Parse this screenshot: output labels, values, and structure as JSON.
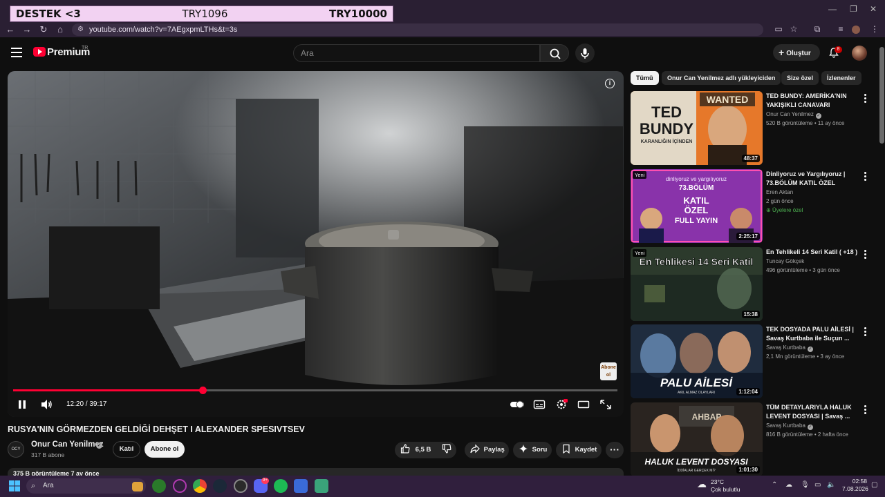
{
  "overlay": {
    "left": "DESTEK <3",
    "middle": "TRY1096",
    "right": "TRY10000"
  },
  "browser": {
    "url": "youtube.com/watch?v=7AEgxpmLTHs&t=3s"
  },
  "header": {
    "logo_text": "Premium",
    "country_code": "TR",
    "search_placeholder": "Ara",
    "create_label": "Oluştur",
    "notification_count": "8"
  },
  "player": {
    "time": "12:20 / 39:17",
    "progress_fraction": 0.314,
    "watermark_text": "Abone ol"
  },
  "video": {
    "title": "RUSYA'NIN GÖRMEZDEN GELDİĞİ DEHŞET I ALEXANDER SPESIVTSEV",
    "channel": "Onur Can Yenilmez",
    "subscribers": "317 B abone",
    "join_label": "Katıl",
    "subscribe_label": "Abone ol",
    "likes": "6,5 B",
    "share_label": "Paylaş",
    "ask_label": "Soru",
    "save_label": "Kaydet",
    "views_date": "375 B görüntüleme  7 ay önce"
  },
  "sidebar": {
    "chips": [
      "Tümü",
      "Onur Can Yenilmez adlı yükleyiciden",
      "Size özel",
      "İzlenenler"
    ],
    "items": [
      {
        "title": "TED BUNDY: AMERİKA'NIN YAKIŞIKLI CANAVARI",
        "channel": "Onur Can Yenilmez",
        "meta": "520 B görüntüleme • 11 ay önce",
        "duration": "48:37",
        "new": "",
        "members": "",
        "verified": true
      },
      {
        "title": "Dinliyoruz ve Yargılıyoruz | 73.BÖLÜM KATIL ÖZEL",
        "channel": "Eren Aktan",
        "meta": "2 gün önce",
        "duration": "2:25:17",
        "new": "Yeni",
        "members": "Üyelere özel",
        "verified": false
      },
      {
        "title": "En Tehlikeli 14 Seri Katil ( +18 )",
        "channel": "Tuncay Gökçek",
        "meta": "496 görüntüleme • 3 gün önce",
        "duration": "15:38",
        "new": "Yeni",
        "members": "",
        "verified": false
      },
      {
        "title": "TEK DOSYADA PALU AİLESİ | Savaş Kurtbaba ile Suçun ...",
        "channel": "Savaş Kurtbaba",
        "meta": "2,1 Mn görüntüleme • 3 ay önce",
        "duration": "1:12:04",
        "new": "",
        "members": "",
        "verified": true
      },
      {
        "title": "TÜM DETAYLARIYLA HALUK LEVENT DOSYASI | Savaş ...",
        "channel": "Savaş Kurtbaba",
        "meta": "816 B görüntüleme • 2 hafta önce",
        "duration": "1:01:30",
        "new": "",
        "members": "",
        "verified": true
      }
    ],
    "thumb_text": {
      "t1a": "TED",
      "t1b": "BUNDY",
      "t1c": "KARANLIĞIN İÇİNDEN",
      "t1d": "WANTED",
      "t2a": "dinliyoruz ve yargılıyoruz",
      "t2b": "73.BÖLÜM",
      "t2c": "KATIL",
      "t2d": "ÖZEL",
      "t2e": "FULL YAYIN",
      "t3a": "En Tehlikesi 14 Seri Katil",
      "t4a": "PALU AİLESİ",
      "t4b": "AKIL ALMAZ OLAYLARI",
      "t5a": "AHBAP",
      "t5b": "HALUK LEVENT DOSYASI",
      "t5c": "İDDİALAR GERÇEK Mİ?"
    }
  },
  "taskbar": {
    "search_placeholder": "Ara",
    "discord_badge": "9+",
    "weather_temp": "23°C",
    "weather_desc": "Çok bulutlu",
    "time": "02:58",
    "date": "7.08.2026"
  },
  "colors": {
    "accent": "#ff0033",
    "background": "#0f0f0f",
    "taskbar": "#301f3d"
  }
}
